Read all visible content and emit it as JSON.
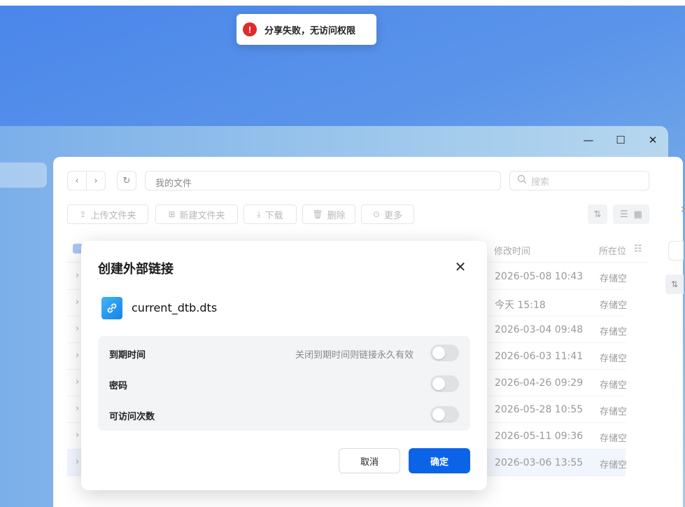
{
  "toast": {
    "message": "分享失败，无访问权限",
    "icon": "error-icon"
  },
  "window_controls": {
    "minimize": "—",
    "maximize": "☐",
    "close": "✕"
  },
  "toolbar": {
    "path": "我的文件",
    "search_placeholder": "搜索",
    "buttons": [
      "上传文件夹",
      "新建文件夹",
      "下载",
      "删除",
      "更多"
    ]
  },
  "table": {
    "columns": [
      "修改时间",
      "所在位"
    ],
    "rows": [
      {
        "modified": "2026-05-08 10:43",
        "location": "存储空"
      },
      {
        "modified": "今天 15:18",
        "location": "存储空"
      },
      {
        "modified": "2026-03-04 09:48",
        "location": "存储空"
      },
      {
        "modified": "2026-06-03 11:41",
        "location": "存储空"
      },
      {
        "modified": "2026-04-26 09:29",
        "location": "存储空"
      },
      {
        "modified": "2026-05-28 10:55",
        "location": "存储空"
      },
      {
        "modified": "2026-05-11 09:36",
        "location": "存储空"
      },
      {
        "modified": "2026-03-06 13:55",
        "location": "存储空"
      }
    ]
  },
  "dialog": {
    "title": "创建外部链接",
    "file_name": "current_dtb.dts",
    "options": [
      {
        "label": "到期时间",
        "hint": "关闭到期时间则链接永久有效",
        "enabled": false
      },
      {
        "label": "密码",
        "enabled": false
      },
      {
        "label": "可访问次数",
        "enabled": false
      }
    ],
    "cancel_label": "取消",
    "ok_label": "确定"
  },
  "colors": {
    "primary": "#0b63e8",
    "error": "#e02b2b"
  }
}
